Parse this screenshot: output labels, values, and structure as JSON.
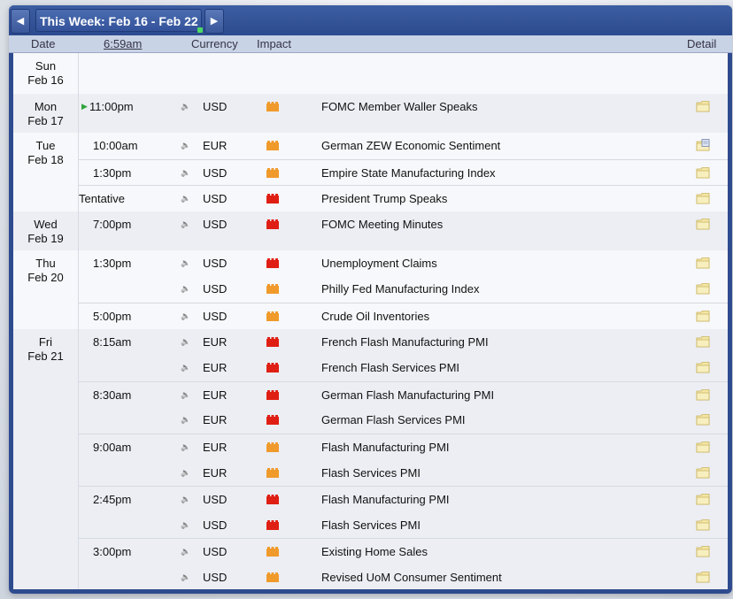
{
  "header": {
    "week_label": "This Week: Feb 16 - Feb 22",
    "prev_icon": "triangle-left-icon",
    "next_icon": "triangle-right-icon"
  },
  "columns": {
    "date": "Date",
    "time": "6:59am",
    "currency": "Currency",
    "impact": "Impact",
    "detail": "Detail"
  },
  "colors": {
    "high_impact": "#e01f14",
    "medium_impact": "#f09a2c",
    "frame": "#2f4b8f",
    "header_row": "#c9d3e6"
  },
  "days": [
    {
      "dow": "Sun",
      "date": "Feb 16",
      "events": []
    },
    {
      "dow": "Mon",
      "date": "Feb 17",
      "events": [
        {
          "time": "11:00pm",
          "current": true,
          "currency": "USD",
          "impact": "medium",
          "event": "FOMC Member Waller Speaks",
          "detail": "folder"
        }
      ]
    },
    {
      "dow": "Tue",
      "date": "Feb 18",
      "events": [
        {
          "time": "10:00am",
          "currency": "EUR",
          "impact": "medium",
          "event": "German ZEW Economic Sentiment",
          "detail": "folder-doc"
        },
        {
          "time": "1:30pm",
          "currency": "USD",
          "impact": "medium",
          "event": "Empire State Manufacturing Index",
          "detail": "folder"
        },
        {
          "time": "Tentative",
          "currency": "USD",
          "impact": "high",
          "event": "President Trump Speaks",
          "detail": "folder"
        }
      ]
    },
    {
      "dow": "Wed",
      "date": "Feb 19",
      "events": [
        {
          "time": "7:00pm",
          "currency": "USD",
          "impact": "high",
          "event": "FOMC Meeting Minutes",
          "detail": "folder"
        }
      ]
    },
    {
      "dow": "Thu",
      "date": "Feb 20",
      "events": [
        {
          "time": "1:30pm",
          "currency": "USD",
          "impact": "high",
          "event": "Unemployment Claims",
          "detail": "folder"
        },
        {
          "time": "",
          "currency": "USD",
          "impact": "medium",
          "event": "Philly Fed Manufacturing Index",
          "detail": "folder"
        },
        {
          "time": "5:00pm",
          "currency": "USD",
          "impact": "medium",
          "event": "Crude Oil Inventories",
          "detail": "folder"
        }
      ]
    },
    {
      "dow": "Fri",
      "date": "Feb 21",
      "events": [
        {
          "time": "8:15am",
          "currency": "EUR",
          "impact": "high",
          "event": "French Flash Manufacturing PMI",
          "detail": "folder"
        },
        {
          "time": "",
          "currency": "EUR",
          "impact": "high",
          "event": "French Flash Services PMI",
          "detail": "folder"
        },
        {
          "time": "8:30am",
          "currency": "EUR",
          "impact": "high",
          "event": "German Flash Manufacturing PMI",
          "detail": "folder"
        },
        {
          "time": "",
          "currency": "EUR",
          "impact": "high",
          "event": "German Flash Services PMI",
          "detail": "folder"
        },
        {
          "time": "9:00am",
          "currency": "EUR",
          "impact": "medium",
          "event": "Flash Manufacturing PMI",
          "detail": "folder"
        },
        {
          "time": "",
          "currency": "EUR",
          "impact": "medium",
          "event": "Flash Services PMI",
          "detail": "folder"
        },
        {
          "time": "2:45pm",
          "currency": "USD",
          "impact": "high",
          "event": "Flash Manufacturing PMI",
          "detail": "folder"
        },
        {
          "time": "",
          "currency": "USD",
          "impact": "high",
          "event": "Flash Services PMI",
          "detail": "folder"
        },
        {
          "time": "3:00pm",
          "currency": "USD",
          "impact": "medium",
          "event": "Existing Home Sales",
          "detail": "folder"
        },
        {
          "time": "",
          "currency": "USD",
          "impact": "medium",
          "event": "Revised UoM Consumer Sentiment",
          "detail": "folder"
        }
      ]
    }
  ]
}
